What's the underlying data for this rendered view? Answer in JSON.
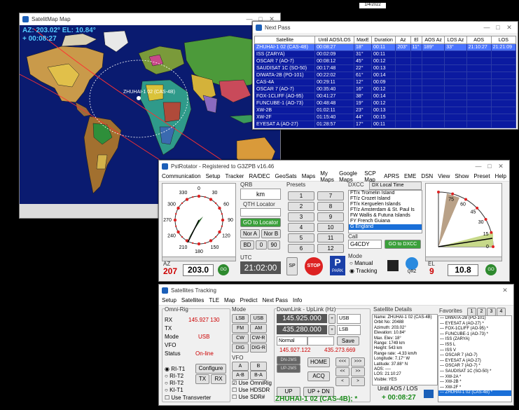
{
  "satmap": {
    "title": "SatelitMap Map",
    "az_el": "AZ: 203.02°  EL: 10.84°",
    "countdown": "+ 00:08:27",
    "sat_label": "ZHUHAI-1 02 (CAS-4B)"
  },
  "nextpass": {
    "title": "Next Pass",
    "columns": [
      "Satellite",
      "Until AOS/LOS",
      "MaxE",
      "Duration",
      "Az",
      "El",
      "AOS Az",
      "LOS Az",
      "AOS",
      "LOS"
    ],
    "rows": [
      [
        "ZHUHAI-1 02 (CAS-4B)",
        "00:08:27",
        "18°",
        "00:11",
        "203°",
        "11°",
        "189°",
        "33°",
        "21:10:27",
        "21:21:09"
      ],
      [
        "ISS (ZARYA)",
        "00:02:09",
        "31°",
        "00:11",
        "",
        "",
        "",
        "",
        "",
        ""
      ],
      [
        "OSCAR 7 (AO-7)",
        "00:08:12",
        "45°",
        "00:12",
        "",
        "",
        "",
        "",
        "",
        ""
      ],
      [
        "SAUDISAT 1C (SO-50)",
        "00:17:48",
        "22°",
        "00:13",
        "",
        "",
        "",
        "",
        "",
        ""
      ],
      [
        "DIWATA-2B (PO-101)",
        "00:22:02",
        "61°",
        "00:14",
        "",
        "",
        "",
        "",
        "",
        ""
      ],
      [
        "CAS-4A",
        "00:29:11",
        "12°",
        "00:09",
        "",
        "",
        "",
        "",
        "",
        ""
      ],
      [
        "OSCAR 7 (AO-7)",
        "00:35:40",
        "16°",
        "00:12",
        "",
        "",
        "",
        "",
        "",
        ""
      ],
      [
        "FOX-1CLIFF (AO-95)",
        "00:41:27",
        "38°",
        "00:14",
        "",
        "",
        "",
        "",
        "",
        ""
      ],
      [
        "FUNCUBE-1 (AO-73)",
        "00:48:48",
        "19°",
        "00:12",
        "",
        "",
        "",
        "",
        "",
        ""
      ],
      [
        "XW-2B",
        "01:02:11",
        "23°",
        "00:13",
        "",
        "",
        "",
        "",
        "",
        ""
      ],
      [
        "XW-2F",
        "01:15:40",
        "44°",
        "00:15",
        "",
        "",
        "",
        "",
        "",
        ""
      ],
      [
        "EYESAT A (AO-27)",
        "01:28:57",
        "17°",
        "00:11",
        "",
        "",
        "",
        "",
        "",
        ""
      ]
    ]
  },
  "pstrotator": {
    "title": "PstRotator - Registered to G3ZPB   v16.46",
    "menu": [
      "Communication",
      "Setup",
      "Tracker",
      "RA/DEC",
      "GeoSats",
      "Maps",
      "My Maps",
      "Google Maps",
      "SCP Map",
      "APRS",
      "EME",
      "DSN",
      "View",
      "Show",
      "Preset",
      "Help"
    ],
    "qrb_label": "QRB",
    "qrb_unit": "km",
    "qth_label": "QTH Locator",
    "goto_locator": "GO to Locator",
    "nor_a": "Nor A",
    "nor_b": "Nor B",
    "bd_label": "BD",
    "bd_values": [
      "0",
      "90"
    ],
    "presets_label": "Presets",
    "presets": [
      "1",
      "2",
      "3",
      "4",
      "5",
      "6",
      "7",
      "8",
      "9",
      "10",
      "11",
      "12"
    ],
    "dxcc_label": "DXCC",
    "dx_local_time": "DX Local Time",
    "dx_list": [
      "FT/x Tromelin Island",
      "FT/z Crozet Island",
      "FT/x Kerguelen Islands",
      "FT/z Amsterdam & St. Paul Is",
      "FW Wallis & Futuna Islands",
      "FY French Guiana",
      "G England"
    ],
    "call_label": "Call",
    "call_value": "G4CDY",
    "goto_dxcc": "GO to DXCC",
    "mode_label": "Mode",
    "mode_manual": "Manual",
    "mode_tracking": "Tracking",
    "az_label": "AZ",
    "az_value": "207",
    "az_set": "203.0",
    "go": "GO",
    "utc_label": "UTC",
    "utc_value": "21:02:00",
    "sp": "SP",
    "stop": "STOP",
    "park": "PARK",
    "qrz": "QRZ",
    "el_label": "EL",
    "el_value": "9",
    "el_set": "10.8",
    "az_ticks": [
      "330",
      "0",
      "30",
      "300",
      "60",
      "270",
      "90",
      "240",
      "120",
      "210",
      "150",
      "180"
    ],
    "el_ticks": [
      "60",
      "75",
      "45",
      "30",
      "15",
      "0"
    ]
  },
  "tracking": {
    "title": "Satellites Tracking",
    "menu": [
      "Setup",
      "Satellites",
      "TLE",
      "Map",
      "Predict",
      "Next Pass",
      "Info"
    ],
    "omni_label": "Omni-Rig",
    "rx_label": "RX",
    "rx_value": "145.927 130",
    "tx_label": "TX",
    "mode_label": "Mode",
    "mode_value": "USB",
    "vfo_label": "VFO",
    "status_label": "Status",
    "status_value": "On-line",
    "rig1": "RI-T1",
    "rig2": "RI-T2",
    "rig3": "RI-T2",
    "rig4": "KI-T1",
    "configure": "Configure",
    "tx_btn": "TX",
    "rx_btn": "RX",
    "use_transverter": "Use Transverter",
    "mode_group": "Mode",
    "mode_buttons": [
      "LSB",
      "USB",
      "FM",
      "AM",
      "CW",
      "CW-R",
      "DIG",
      "DIG-R"
    ],
    "vfo_group": "VFO",
    "vfo_buttons": [
      "A",
      "B",
      "A-B",
      "B-A"
    ],
    "use_omni": "Use OmniRig",
    "use_hdsdr": "Use HDSDR",
    "use_sdr": "Use SDR#",
    "downlink_label": "DownLink - UpLink (Hz)",
    "downlink": "145.925.000",
    "downlink_mode": "USB",
    "uplink": "435.280.000",
    "uplink_mode": "LSB",
    "normal": "Normal",
    "save": "Save",
    "rx_freq": "145.927.122",
    "tx_freq": "435.273.669",
    "dn_btn": "DN-2MS",
    "up_btn": "UP-2MS",
    "home": "HOME",
    "acq": "ACQ",
    "up": "UP",
    "up_dn": "UP + DN",
    "arrows": [
      "<<<",
      ">>>",
      "<<",
      ">>",
      "<",
      ">"
    ],
    "details_label": "Satellite Details",
    "details": [
      "Name: ZHUHAI-1 02 (CAS-4B)",
      "Orbit No: 20488",
      "Azimuth: 203.02°",
      "Elevation: 10.84°",
      "Max. Elev: 18°",
      "Range: 1749 km",
      "Height: 543 km",
      "Range rate: -4.33 km/h",
      "Longitude: 7.17° W",
      "Latitude: 37.88° N",
      "AOS: ----",
      "LOS: 21:10:27",
      "Visible: YES"
    ],
    "until_label": "Until AOS / LOS",
    "until_value": "+ 00:08:27",
    "sat_name": "ZHUHAI-1 02 (CAS-4B); *",
    "fav_label": "Favorites",
    "fav_tabs": [
      "1",
      "2",
      "3",
      "4"
    ],
    "favorites": [
      "DIWATA-2B (PO-101)",
      "EYESAT A (AO-27) *",
      "FOX-1CLIFF (AO-95) *",
      "FUNCUBE-1 (AO-73) *",
      "ISS (ZARYA)",
      "ISS L",
      "ISS V",
      "OSCAR 7 (AO-7)",
      "EYESAT A (AO-27)",
      "OSCAR 7 (AO-7) *",
      "SAUDISAT 1C (SO-50) *",
      "XW-2A *",
      "XW-2B *",
      "XW-2F *",
      "ZHUHAI-1 02 (CAS-4B) *"
    ]
  },
  "topbar_text": "1/4/2022"
}
